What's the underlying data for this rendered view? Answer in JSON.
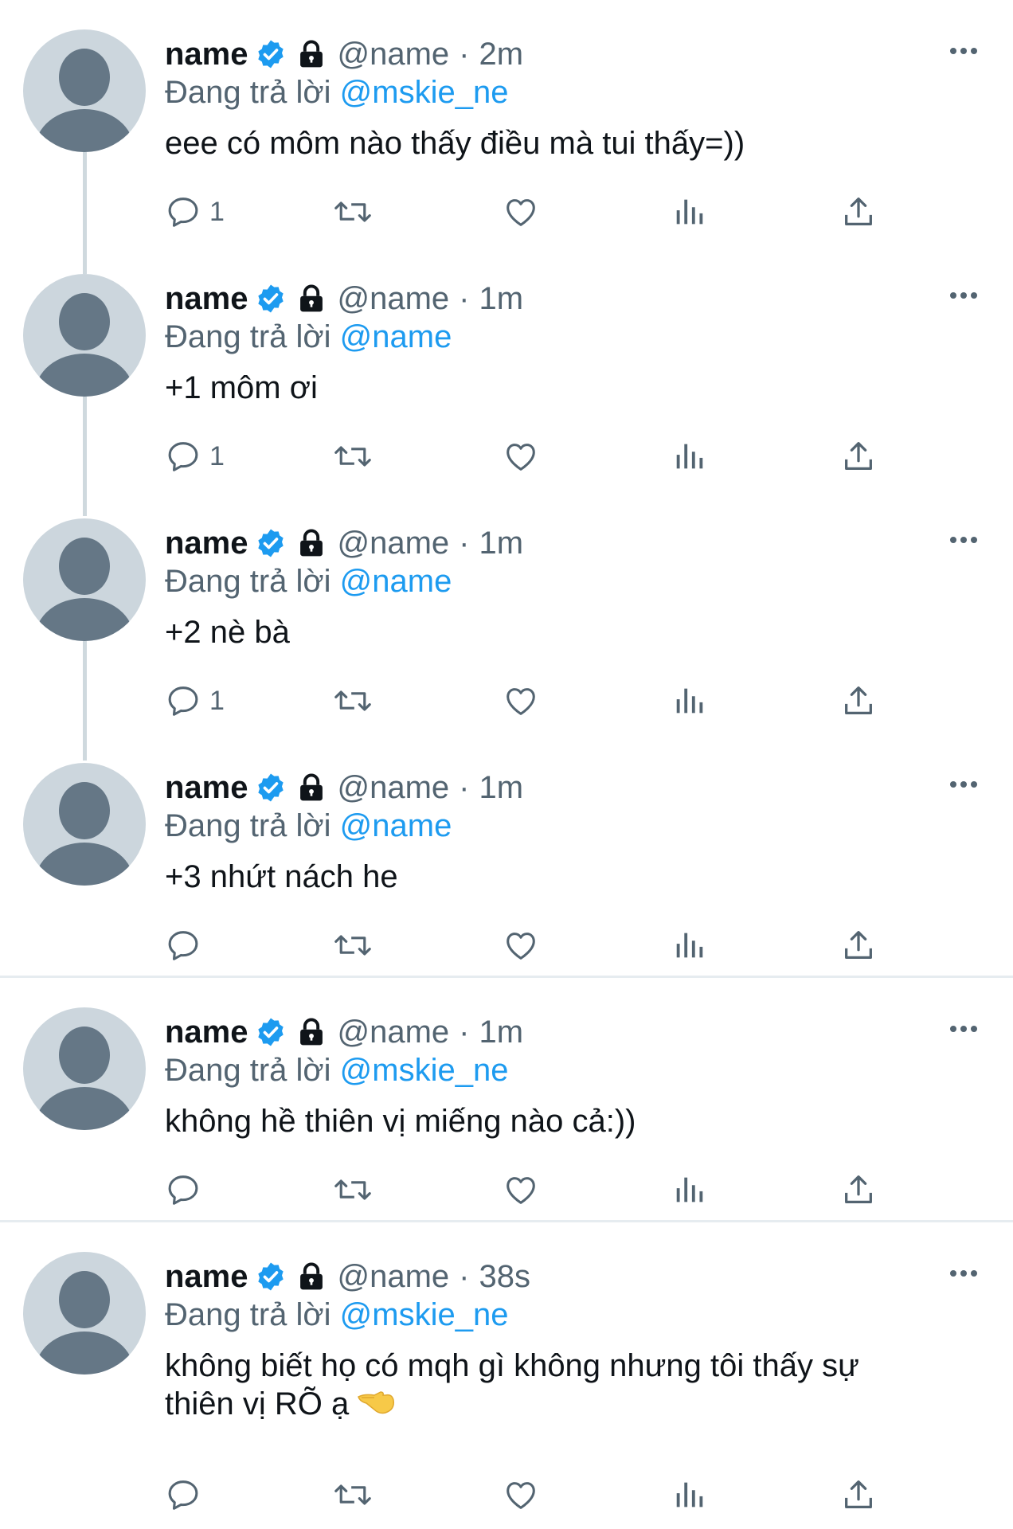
{
  "colors": {
    "accent": "#1d9bf0",
    "muted": "#536471",
    "text": "#0f1419",
    "avatar_bg": "#ccd6dd",
    "avatar_fg": "#657786",
    "thread_line": "#cfd9de"
  },
  "icons": {
    "reply": "reply-icon",
    "retweet": "retweet-icon",
    "like": "heart-icon",
    "views": "views-icon",
    "share": "share-icon",
    "more": "more-icon",
    "verified": "verified-badge-icon",
    "lock": "lock-icon"
  },
  "tweets": [
    {
      "name": "name",
      "handle": "@name",
      "separator": "·",
      "time": "2m",
      "reply_prefix": "Đang trả lời",
      "reply_to": "@mskie_ne",
      "text_lines": [
        "eee có môm nào thấy điều mà tui thấy=))"
      ],
      "reply_count": "1"
    },
    {
      "name": "name",
      "handle": "@name",
      "separator": "·",
      "time": "1m",
      "reply_prefix": "Đang trả lời",
      "reply_to": "@name",
      "text_lines": [
        "+1 môm ơi"
      ],
      "reply_count": "1"
    },
    {
      "name": "name",
      "handle": "@name",
      "separator": "·",
      "time": "1m",
      "reply_prefix": "Đang trả lời",
      "reply_to": "@name",
      "text_lines": [
        "+2 nè bà"
      ],
      "reply_count": "1"
    },
    {
      "name": "name",
      "handle": "@name",
      "separator": "·",
      "time": "1m",
      "reply_prefix": "Đang trả lời",
      "reply_to": "@name",
      "text_lines": [
        "+3 nhứt nách he"
      ],
      "reply_count": ""
    },
    {
      "name": "name",
      "handle": "@name",
      "separator": "·",
      "time": "1m",
      "reply_prefix": "Đang trả lời",
      "reply_to": "@mskie_ne",
      "text_lines": [
        "không hề thiên vị miếng nào cả:))"
      ],
      "reply_count": ""
    },
    {
      "name": "name",
      "handle": "@name",
      "separator": "·",
      "time": "38s",
      "reply_prefix": "Đang trả lời",
      "reply_to": "@mskie_ne",
      "text_lines": [
        "không biết họ có mqh gì không nhưng tôi thấy sự",
        "thiên vị RÕ ạ"
      ],
      "emoji": "pointing-hand-emoji",
      "reply_count": ""
    }
  ]
}
